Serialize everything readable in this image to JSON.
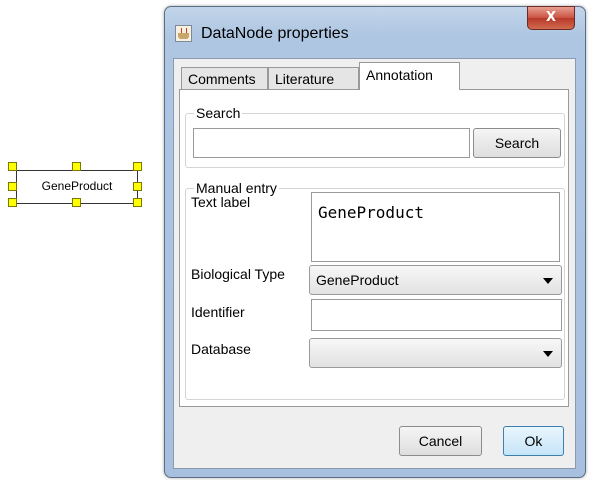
{
  "canvas": {
    "node_label": "GeneProduct"
  },
  "dialog": {
    "title": "DataNode properties",
    "close_glyph": "X",
    "tabs": [
      {
        "label": "Comments"
      },
      {
        "label": "Literature"
      },
      {
        "label": "Annotation",
        "active": true
      }
    ],
    "search": {
      "group_title": "Search",
      "input_value": "",
      "button_label": "Search"
    },
    "manual_entry": {
      "group_title": "Manual entry",
      "text_label": {
        "label": "Text label",
        "value": "GeneProduct"
      },
      "biological_type": {
        "label": "Biological Type",
        "value": "GeneProduct"
      },
      "identifier": {
        "label": "Identifier",
        "value": ""
      },
      "database": {
        "label": "Database",
        "value": ""
      }
    },
    "buttons": {
      "cancel": "Cancel",
      "ok": "Ok"
    }
  },
  "colors": {
    "handle": "#ffff00",
    "title_bar": "#aec6e2",
    "close_button": "#c9513f",
    "ok_button_border": "#3c7fb1"
  }
}
